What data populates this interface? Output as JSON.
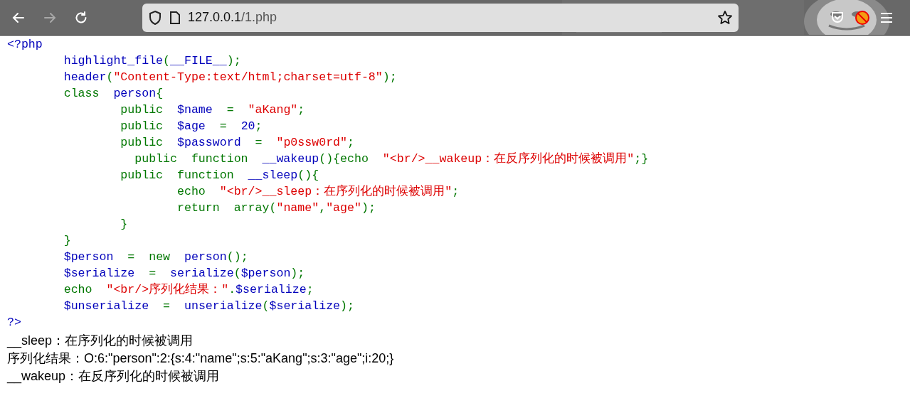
{
  "browser": {
    "nav_buttons": [
      {
        "kind": "back",
        "disabled": false
      },
      {
        "kind": "forward",
        "disabled": true
      },
      {
        "kind": "reload",
        "disabled": false
      }
    ],
    "url": {
      "host": "127.0.0.1",
      "path": "/1.php"
    }
  },
  "code": [
    [
      {
        "kind": "default",
        "text": "<?php"
      }
    ],
    [
      {
        "kind": "default",
        "text": "\thighlight_file"
      },
      {
        "kind": "keyword",
        "text": "("
      },
      {
        "kind": "default",
        "text": "__FILE__"
      },
      {
        "kind": "keyword",
        "text": ");"
      }
    ],
    [
      {
        "kind": "default",
        "text": "\theader"
      },
      {
        "kind": "keyword",
        "text": "("
      },
      {
        "kind": "string",
        "text": "\"Content-Type:text/html;charset=utf-8\""
      },
      {
        "kind": "keyword",
        "text": ");"
      }
    ],
    [
      {
        "kind": "keyword",
        "text": "\tclass  "
      },
      {
        "kind": "default",
        "text": "person"
      },
      {
        "kind": "keyword",
        "text": "{"
      }
    ],
    [
      {
        "kind": "keyword",
        "text": "\t\tpublic  "
      },
      {
        "kind": "default",
        "text": "$name  "
      },
      {
        "kind": "keyword",
        "text": "=  "
      },
      {
        "kind": "string",
        "text": "\"aKang\""
      },
      {
        "kind": "keyword",
        "text": ";"
      }
    ],
    [
      {
        "kind": "keyword",
        "text": "\t\tpublic  "
      },
      {
        "kind": "default",
        "text": "$age  "
      },
      {
        "kind": "keyword",
        "text": "=  "
      },
      {
        "kind": "default",
        "text": "20"
      },
      {
        "kind": "keyword",
        "text": ";"
      }
    ],
    [
      {
        "kind": "keyword",
        "text": "\t\tpublic  "
      },
      {
        "kind": "default",
        "text": "$password  "
      },
      {
        "kind": "keyword",
        "text": "=  "
      },
      {
        "kind": "string",
        "text": "\"p0ssw0rd\""
      },
      {
        "kind": "keyword",
        "text": ";"
      }
    ],
    [
      {
        "kind": "keyword",
        "text": "\t\t  public  function  "
      },
      {
        "kind": "default",
        "text": "__wakeup"
      },
      {
        "kind": "keyword",
        "text": "(){echo  "
      },
      {
        "kind": "string",
        "text": "\"<br/>__wakeup：在反序列化的时候被调用\""
      },
      {
        "kind": "keyword",
        "text": ";}"
      }
    ],
    [
      {
        "kind": "keyword",
        "text": "\t\tpublic  function  "
      },
      {
        "kind": "default",
        "text": "__sleep"
      },
      {
        "kind": "keyword",
        "text": "(){"
      }
    ],
    [
      {
        "kind": "keyword",
        "text": "\t\t\techo  "
      },
      {
        "kind": "string",
        "text": "\"<br/>__sleep：在序列化的时候被调用\""
      },
      {
        "kind": "keyword",
        "text": ";"
      }
    ],
    [
      {
        "kind": "keyword",
        "text": "\t\t\treturn  array("
      },
      {
        "kind": "string",
        "text": "\"name\""
      },
      {
        "kind": "keyword",
        "text": ","
      },
      {
        "kind": "string",
        "text": "\"age\""
      },
      {
        "kind": "keyword",
        "text": ");"
      }
    ],
    [
      {
        "kind": "keyword",
        "text": "\t\t}"
      }
    ],
    [
      {
        "kind": "keyword",
        "text": "\t}"
      }
    ],
    [
      {
        "kind": "default",
        "text": "\t$person  "
      },
      {
        "kind": "keyword",
        "text": "=  new  "
      },
      {
        "kind": "default",
        "text": "person"
      },
      {
        "kind": "keyword",
        "text": "();"
      }
    ],
    [
      {
        "kind": "default",
        "text": "\t$serialize  "
      },
      {
        "kind": "keyword",
        "text": "=  "
      },
      {
        "kind": "default",
        "text": "serialize"
      },
      {
        "kind": "keyword",
        "text": "("
      },
      {
        "kind": "default",
        "text": "$person"
      },
      {
        "kind": "keyword",
        "text": ");"
      }
    ],
    [
      {
        "kind": "keyword",
        "text": "\techo  "
      },
      {
        "kind": "string",
        "text": "\"<br/>序列化结果：\""
      },
      {
        "kind": "keyword",
        "text": "."
      },
      {
        "kind": "default",
        "text": "$serialize"
      },
      {
        "kind": "keyword",
        "text": ";"
      }
    ],
    [
      {
        "kind": "default",
        "text": "\t$unserialize  "
      },
      {
        "kind": "keyword",
        "text": "=  "
      },
      {
        "kind": "default",
        "text": "unserialize"
      },
      {
        "kind": "keyword",
        "text": "("
      },
      {
        "kind": "default",
        "text": "$serialize"
      },
      {
        "kind": "keyword",
        "text": ");"
      }
    ],
    [
      {
        "kind": "default",
        "text": "?>"
      }
    ]
  ],
  "output": [
    "__sleep：在序列化的时候被调用",
    "序列化结果：O:6:\"person\":2:{s:4:\"name\";s:5:\"aKang\";s:3:\"age\";i:20;}",
    "__wakeup：在反序列化的时候被调用"
  ]
}
